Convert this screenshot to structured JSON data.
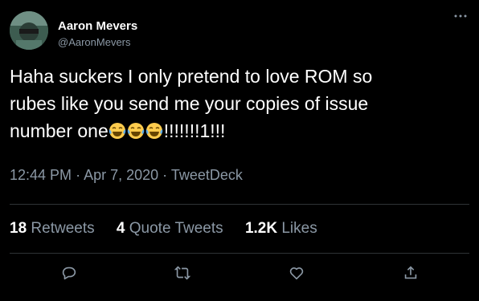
{
  "user": {
    "name": "Aaron Mevers",
    "handle": "@AaronMevers"
  },
  "tweet": {
    "text_line1": "Haha suckers I only pretend to love ROM so",
    "text_line2": "rubes like you send me your copies of issue",
    "text_line3_prefix": "number one",
    "text_line3_suffix": "!!!!!!!1!!!",
    "emoji": [
      "face-with-tears-of-joy",
      "face-with-tears-of-joy",
      "face-with-tears-of-joy"
    ]
  },
  "meta": {
    "time": "12:44 PM",
    "separator": "·",
    "date": "Apr 7, 2020",
    "source": "TweetDeck"
  },
  "stats": {
    "retweets_count": "18",
    "retweets_label": "Retweets",
    "quotes_count": "4",
    "quotes_label": "Quote Tweets",
    "likes_count": "1.2K",
    "likes_label": "Likes"
  },
  "icons": {
    "more": "more-icon",
    "reply": "reply-icon",
    "retweet": "retweet-icon",
    "like": "like-icon",
    "share": "share-icon"
  },
  "colors": {
    "background": "#000000",
    "text": "#ffffff",
    "secondary_text": "#8b98a5",
    "divider": "#2f3336"
  }
}
